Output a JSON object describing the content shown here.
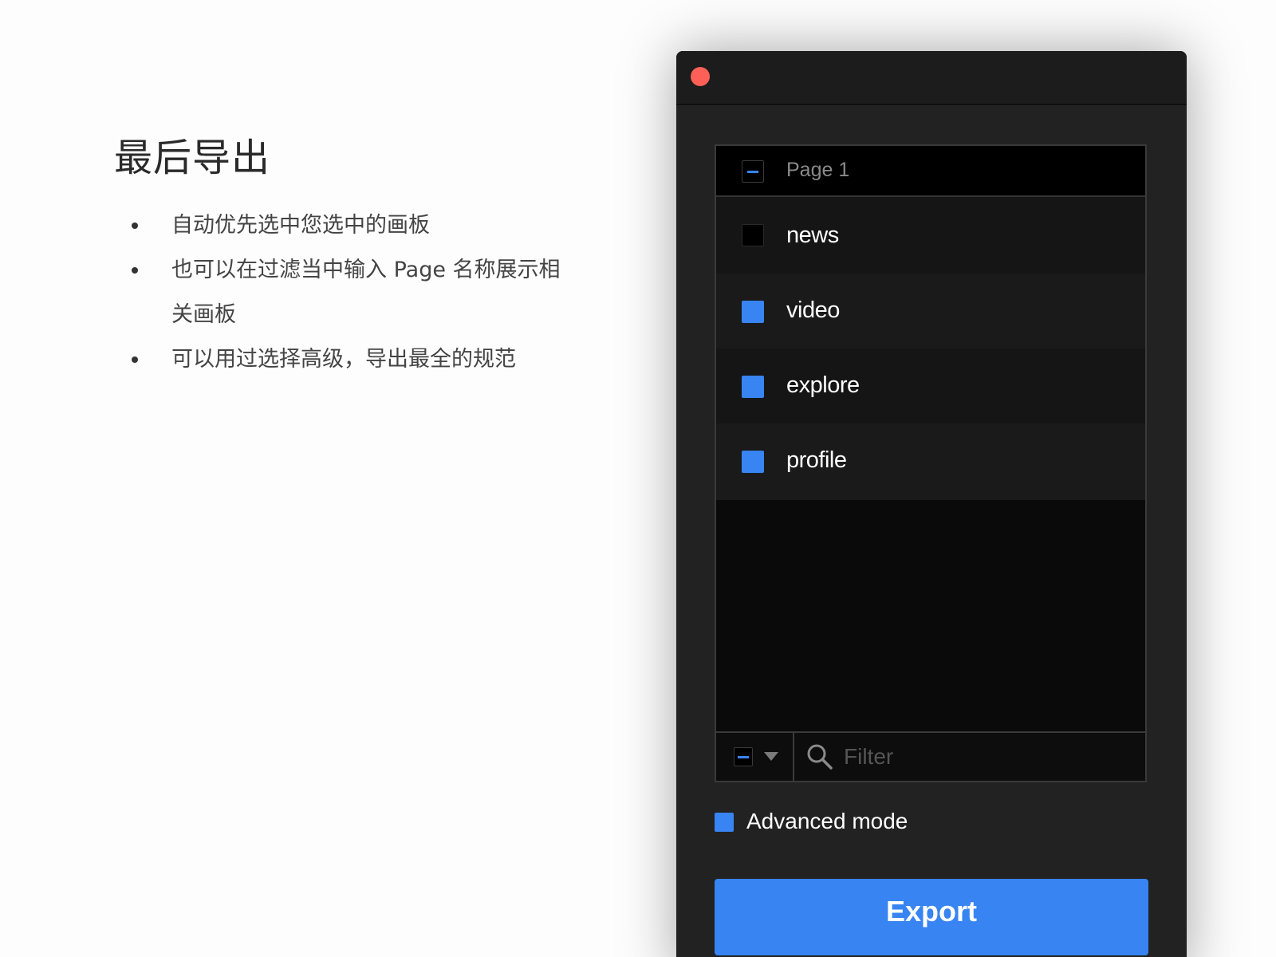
{
  "slide": {
    "title": "最后导出",
    "bullets": [
      "自动优先选中您选中的画板",
      "也可以在过滤当中输入 Page 名称展示相关画板",
      "可以用过选择高级，导出最全的规范"
    ]
  },
  "dialog": {
    "page_header": {
      "label": "Page 1",
      "checkbox_state": "mixed"
    },
    "artboards": [
      {
        "label": "news",
        "checked": false
      },
      {
        "label": "video",
        "checked": true
      },
      {
        "label": "explore",
        "checked": true
      },
      {
        "label": "profile",
        "checked": true
      }
    ],
    "filter": {
      "placeholder": "Filter",
      "value": ""
    },
    "advanced_mode": {
      "label": "Advanced mode",
      "checked": true
    },
    "export_label": "Export"
  },
  "colors": {
    "accent": "#3784f2",
    "close_button": "#fe5f57",
    "window_bg": "#222222"
  },
  "icons": {
    "close": "close-dot-icon",
    "search": "search-icon",
    "dropdown": "caret-down-icon"
  }
}
